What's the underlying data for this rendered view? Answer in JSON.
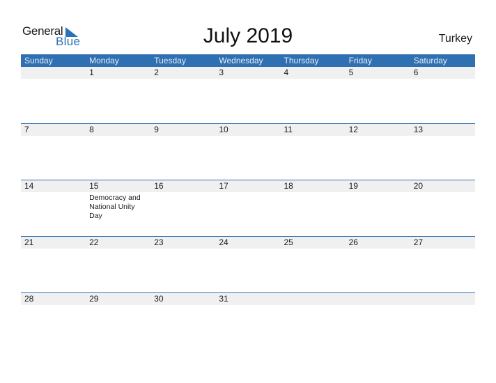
{
  "logo": {
    "word1": "General",
    "word2": "Blue",
    "accent_color": "#2a72b8"
  },
  "title": "July 2019",
  "country": "Turkey",
  "colors": {
    "header_bg": "#2e70b2",
    "date_band": "#f0f0f0"
  },
  "weekdays": [
    "Sunday",
    "Monday",
    "Tuesday",
    "Wednesday",
    "Thursday",
    "Friday",
    "Saturday"
  ],
  "weeks": [
    {
      "days": [
        {
          "num": "",
          "event": ""
        },
        {
          "num": "1",
          "event": ""
        },
        {
          "num": "2",
          "event": ""
        },
        {
          "num": "3",
          "event": ""
        },
        {
          "num": "4",
          "event": ""
        },
        {
          "num": "5",
          "event": ""
        },
        {
          "num": "6",
          "event": ""
        }
      ]
    },
    {
      "days": [
        {
          "num": "7",
          "event": ""
        },
        {
          "num": "8",
          "event": ""
        },
        {
          "num": "9",
          "event": ""
        },
        {
          "num": "10",
          "event": ""
        },
        {
          "num": "11",
          "event": ""
        },
        {
          "num": "12",
          "event": ""
        },
        {
          "num": "13",
          "event": ""
        }
      ]
    },
    {
      "days": [
        {
          "num": "14",
          "event": ""
        },
        {
          "num": "15",
          "event": "Democracy and National Unity Day"
        },
        {
          "num": "16",
          "event": ""
        },
        {
          "num": "17",
          "event": ""
        },
        {
          "num": "18",
          "event": ""
        },
        {
          "num": "19",
          "event": ""
        },
        {
          "num": "20",
          "event": ""
        }
      ]
    },
    {
      "days": [
        {
          "num": "21",
          "event": ""
        },
        {
          "num": "22",
          "event": ""
        },
        {
          "num": "23",
          "event": ""
        },
        {
          "num": "24",
          "event": ""
        },
        {
          "num": "25",
          "event": ""
        },
        {
          "num": "26",
          "event": ""
        },
        {
          "num": "27",
          "event": ""
        }
      ]
    },
    {
      "days": [
        {
          "num": "28",
          "event": ""
        },
        {
          "num": "29",
          "event": ""
        },
        {
          "num": "30",
          "event": ""
        },
        {
          "num": "31",
          "event": ""
        },
        {
          "num": "",
          "event": ""
        },
        {
          "num": "",
          "event": ""
        },
        {
          "num": "",
          "event": ""
        }
      ]
    }
  ]
}
